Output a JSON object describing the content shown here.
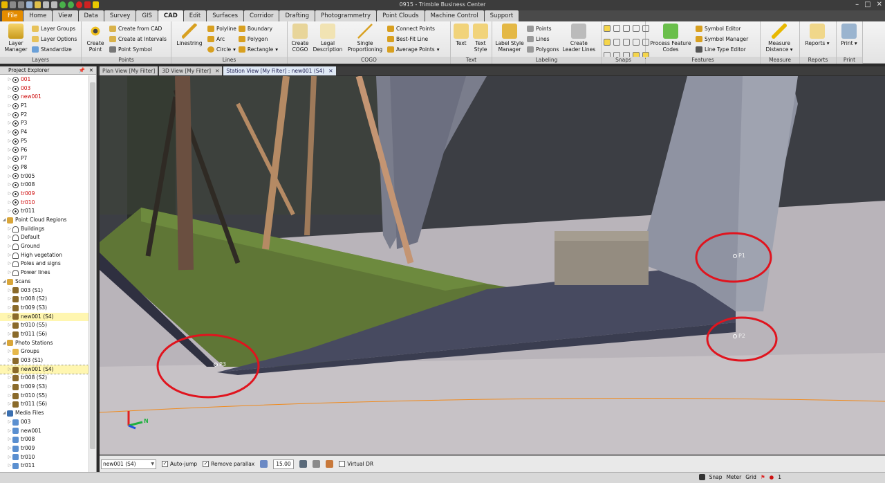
{
  "app": {
    "title": "0915 - Trimble Business Center"
  },
  "colors": {
    "accent": "#e48c00",
    "annotation": "#e0141e",
    "ribbon_bg": "#eeeeee",
    "selected": "#fff6b0"
  },
  "menu_tabs": [
    "File",
    "Home",
    "View",
    "Data",
    "Survey",
    "GIS",
    "CAD",
    "Edit",
    "Surfaces",
    "Corridor",
    "Drafting",
    "Photogrammetry",
    "Point Clouds",
    "Machine Control",
    "Support"
  ],
  "ribbon": {
    "layers": {
      "label": "Layers",
      "layer_manager": "Layer Manager",
      "layer_groups": "Layer Groups",
      "layer_options": "Layer Options",
      "standardize": "Standardize"
    },
    "points": {
      "label": "Points",
      "create_point": "Create Point",
      "create_from_cad": "Create from CAD",
      "create_at_intervals": "Create at Intervals",
      "point_symbol": "Point Symbol"
    },
    "lines": {
      "label": "Lines",
      "linestring": "Linestring",
      "polyline": "Polyline",
      "arc": "Arc",
      "circle": "Circle",
      "boundary": "Boundary",
      "polygon": "Polygon",
      "rectangle": "Rectangle"
    },
    "cogo": {
      "label": "COGO",
      "create_cogo": "Create COGO",
      "legal_description": "Legal Description",
      "single_proportioning": "Single Proportioning",
      "connect_points": "Connect Points",
      "best_fit_line": "Best-Fit Line",
      "average_points": "Average Points"
    },
    "text": {
      "label": "Text",
      "text": "Text",
      "text_style": "Text Style"
    },
    "labeling": {
      "label": "Labeling",
      "label_style_manager": "Label Style Manager",
      "points": "Points",
      "lines": "Lines",
      "polygons": "Polygons",
      "create_leader_lines": "Create Leader Lines"
    },
    "snaps": {
      "label": "Snaps"
    },
    "features": {
      "label": "Features",
      "process_feature_codes": "Process Feature Codes",
      "symbol_editor": "Symbol Editor",
      "symbol_manager": "Symbol Manager",
      "line_type_editor": "Line Type Editor"
    },
    "measure": {
      "label": "Measure",
      "measure_distance": "Measure Distance"
    },
    "reports": {
      "label": "Reports",
      "reports": "Reports"
    },
    "print": {
      "label": "Print",
      "print": "Print"
    }
  },
  "explorer": {
    "title": "Project Explorer",
    "items": [
      {
        "label": "001",
        "red": true,
        "icon": "point"
      },
      {
        "label": "003",
        "red": true,
        "icon": "point"
      },
      {
        "label": "new001",
        "red": true,
        "icon": "point"
      },
      {
        "label": "P1",
        "red": false,
        "icon": "point"
      },
      {
        "label": "P2",
        "red": false,
        "icon": "point"
      },
      {
        "label": "P3",
        "red": false,
        "icon": "point"
      },
      {
        "label": "P4",
        "red": false,
        "icon": "point"
      },
      {
        "label": "P5",
        "red": false,
        "icon": "point"
      },
      {
        "label": "P6",
        "red": false,
        "icon": "point"
      },
      {
        "label": "P7",
        "red": false,
        "icon": "point"
      },
      {
        "label": "P8",
        "red": false,
        "icon": "point"
      },
      {
        "label": "tr005",
        "red": false,
        "icon": "point"
      },
      {
        "label": "tr008",
        "red": false,
        "icon": "point"
      },
      {
        "label": "tr009",
        "red": true,
        "icon": "point"
      },
      {
        "label": "tr010",
        "red": true,
        "icon": "point"
      },
      {
        "label": "tr011",
        "red": false,
        "icon": "point"
      },
      {
        "label": "Point Cloud Regions",
        "red": false,
        "icon": "folder",
        "level": 0
      },
      {
        "label": "Buildings",
        "red": false,
        "icon": "region"
      },
      {
        "label": "Default",
        "red": false,
        "icon": "region"
      },
      {
        "label": "Ground",
        "red": false,
        "icon": "region"
      },
      {
        "label": "High vegetation",
        "red": false,
        "icon": "region"
      },
      {
        "label": "Poles and signs",
        "red": false,
        "icon": "region"
      },
      {
        "label": "Power lines",
        "red": false,
        "icon": "region"
      },
      {
        "label": "Scans",
        "red": false,
        "icon": "folder",
        "level": 0
      },
      {
        "label": "003 (S1)",
        "red": false,
        "icon": "scan"
      },
      {
        "label": "tr008 (S2)",
        "red": false,
        "icon": "scan"
      },
      {
        "label": "tr009 (S3)",
        "red": false,
        "icon": "scan"
      },
      {
        "label": "new001 (S4)",
        "red": false,
        "icon": "scan",
        "highlight": true
      },
      {
        "label": "tr010 (S5)",
        "red": false,
        "icon": "scan"
      },
      {
        "label": "tr011 (S6)",
        "red": false,
        "icon": "scan"
      },
      {
        "label": "Photo Stations",
        "red": false,
        "icon": "folder",
        "level": 0
      },
      {
        "label": "Groups",
        "red": false,
        "icon": "group"
      },
      {
        "label": "003 (S1)",
        "red": false,
        "icon": "scan"
      },
      {
        "label": "new001 (S4)",
        "red": false,
        "icon": "scan",
        "selected": true
      },
      {
        "label": "tr008 (S2)",
        "red": false,
        "icon": "scan"
      },
      {
        "label": "tr009 (S3)",
        "red": false,
        "icon": "scan"
      },
      {
        "label": "tr010 (S5)",
        "red": false,
        "icon": "scan"
      },
      {
        "label": "tr011 (S6)",
        "red": false,
        "icon": "scan"
      },
      {
        "label": "Media Files",
        "red": false,
        "icon": "media",
        "level": 0
      },
      {
        "label": "003",
        "red": false,
        "icon": "mediafolder"
      },
      {
        "label": "new001",
        "red": false,
        "icon": "mediafolder"
      },
      {
        "label": "tr008",
        "red": false,
        "icon": "mediafolder"
      },
      {
        "label": "tr009",
        "red": false,
        "icon": "mediafolder"
      },
      {
        "label": "tr010",
        "red": false,
        "icon": "mediafolder"
      },
      {
        "label": "tr011",
        "red": false,
        "icon": "mediafolder"
      }
    ]
  },
  "doc_tabs": [
    {
      "label": "Plan View [My Filter]",
      "active": false,
      "closable": false
    },
    {
      "label": "3D View [My Filter]",
      "active": false,
      "closable": true
    },
    {
      "label": "Station View [My Filter] : new001 (S4)",
      "active": true,
      "closable": true
    }
  ],
  "viewport": {
    "points": [
      {
        "label": "P1"
      },
      {
        "label": "P2"
      },
      {
        "label": "P3"
      }
    ],
    "axis": {
      "north_label": "N"
    }
  },
  "station_toolbar": {
    "station": "new001 (S4)",
    "auto_jump": {
      "label": "Auto-jump",
      "checked": true
    },
    "remove_parallax": {
      "label": "Remove parallax",
      "checked": true
    },
    "value": "15.00",
    "virtual_dr": {
      "label": "Virtual DR",
      "checked": false
    }
  },
  "status": {
    "snap": "Snap",
    "meter": "Meter",
    "grid": "Grid",
    "count": "1"
  }
}
